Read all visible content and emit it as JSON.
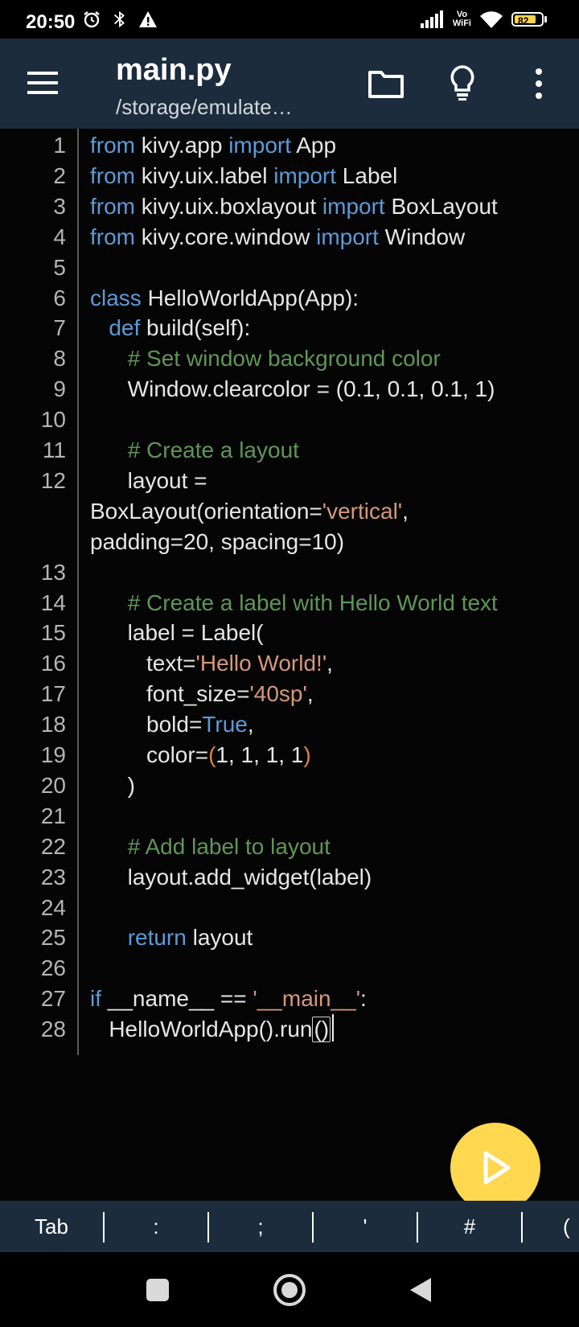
{
  "status_bar": {
    "time": "20:50",
    "vowifi_top": "Vo",
    "vowifi_bottom": "WiFi",
    "battery_level": "82",
    "icons_left": [
      "alarm-icon",
      "bluetooth-icon",
      "warning-icon"
    ],
    "icons_right": [
      "signal-icon",
      "wifi-icon",
      "battery-icon"
    ]
  },
  "app_bar": {
    "title": "main.py",
    "subtitle": "/storage/emulate…",
    "icons": [
      "menu-icon",
      "folder-icon",
      "lightbulb-icon",
      "more-vert-icon"
    ]
  },
  "editor": {
    "lines": [
      {
        "n": "1",
        "tokens": [
          {
            "t": "from",
            "c": "kw"
          },
          {
            "t": " kivy.app "
          },
          {
            "t": "import",
            "c": "kw"
          },
          {
            "t": " App"
          }
        ]
      },
      {
        "n": "2",
        "tokens": [
          {
            "t": "from",
            "c": "kw"
          },
          {
            "t": " kivy.uix.label "
          },
          {
            "t": "import",
            "c": "kw"
          },
          {
            "t": " Label"
          }
        ]
      },
      {
        "n": "3",
        "tokens": [
          {
            "t": "from",
            "c": "kw"
          },
          {
            "t": " kivy.uix.boxlayout "
          },
          {
            "t": "import",
            "c": "kw"
          },
          {
            "t": " BoxLayout"
          }
        ]
      },
      {
        "n": "4",
        "tokens": [
          {
            "t": "from",
            "c": "kw"
          },
          {
            "t": " kivy.core.window "
          },
          {
            "t": "import",
            "c": "kw"
          },
          {
            "t": " Window"
          }
        ]
      },
      {
        "n": "5",
        "tokens": []
      },
      {
        "n": "6",
        "tokens": [
          {
            "t": "class",
            "c": "kw"
          },
          {
            "t": " HelloWorldApp(App):"
          }
        ]
      },
      {
        "n": "7",
        "tokens": [
          {
            "t": "   "
          },
          {
            "t": "def",
            "c": "kw"
          },
          {
            "t": " build(self):"
          }
        ]
      },
      {
        "n": "8",
        "tokens": [
          {
            "t": "      "
          },
          {
            "t": "# Set window background color",
            "c": "cm"
          }
        ]
      },
      {
        "n": "9",
        "tokens": [
          {
            "t": "      Window.clearcolor = (0.1, 0.1, 0.1, 1)"
          }
        ]
      },
      {
        "n": "10",
        "tokens": []
      },
      {
        "n": "11",
        "tokens": [
          {
            "t": "      "
          },
          {
            "t": "# Create a layout",
            "c": "cm"
          }
        ]
      },
      {
        "n": "12",
        "tokens": [
          {
            "t": "      layout ="
          }
        ]
      },
      {
        "n": "",
        "tokens": [
          {
            "t": "BoxLayout(orientation="
          },
          {
            "t": "'vertical'",
            "c": "st"
          },
          {
            "t": ","
          }
        ]
      },
      {
        "n": "",
        "tokens": [
          {
            "t": "padding=20, spacing=10)"
          }
        ]
      },
      {
        "n": "13",
        "tokens": []
      },
      {
        "n": "14",
        "tokens": [
          {
            "t": "      "
          },
          {
            "t": "# Create a label with Hello World text",
            "c": "cm"
          }
        ]
      },
      {
        "n": "15",
        "tokens": [
          {
            "t": "      label = Label("
          }
        ]
      },
      {
        "n": "16",
        "tokens": [
          {
            "t": "         text="
          },
          {
            "t": "'Hello World!'",
            "c": "st"
          },
          {
            "t": ","
          }
        ]
      },
      {
        "n": "17",
        "tokens": [
          {
            "t": "         font_size="
          },
          {
            "t": "'40sp'",
            "c": "st"
          },
          {
            "t": ","
          }
        ]
      },
      {
        "n": "18",
        "tokens": [
          {
            "t": "         bold="
          },
          {
            "t": "True",
            "c": "kw"
          },
          {
            "t": ","
          }
        ]
      },
      {
        "n": "19",
        "tokens": [
          {
            "t": "         color="
          },
          {
            "t": "(",
            "c": "br"
          },
          {
            "t": "1, 1, 1, 1"
          },
          {
            "t": ")",
            "c": "br"
          }
        ]
      },
      {
        "n": "20",
        "tokens": [
          {
            "t": "      )"
          }
        ]
      },
      {
        "n": "21",
        "tokens": []
      },
      {
        "n": "22",
        "tokens": [
          {
            "t": "      "
          },
          {
            "t": "# Add label to layout",
            "c": "cm"
          }
        ]
      },
      {
        "n": "23",
        "tokens": [
          {
            "t": "      layout.add_widget(label)"
          }
        ]
      },
      {
        "n": "24",
        "tokens": []
      },
      {
        "n": "25",
        "tokens": [
          {
            "t": "      "
          },
          {
            "t": "return",
            "c": "kw"
          },
          {
            "t": " layout"
          }
        ]
      },
      {
        "n": "26",
        "tokens": []
      },
      {
        "n": "27",
        "tokens": [
          {
            "t": "if",
            "c": "kw"
          },
          {
            "t": " __name__ == "
          },
          {
            "t": "'__main__'",
            "c": "st"
          },
          {
            "t": ":"
          }
        ]
      },
      {
        "n": "28",
        "tokens": [
          {
            "t": "   HelloWorldApp().run"
          },
          {
            "t": "()",
            "c": "cursor"
          }
        ]
      }
    ]
  },
  "run_button": {
    "icon": "play-icon"
  },
  "extra_keys": [
    "Tab",
    ":",
    ";",
    "'",
    "#",
    "("
  ],
  "nav_bar": {
    "icons": [
      "recents-square-icon",
      "home-circle-icon",
      "back-triangle-icon"
    ]
  },
  "colors": {
    "app_bar": "#1c2c3c",
    "keyword": "#5d9ad8",
    "comment": "#5f9657",
    "string": "#d6987a",
    "fab": "#ffd84f"
  }
}
